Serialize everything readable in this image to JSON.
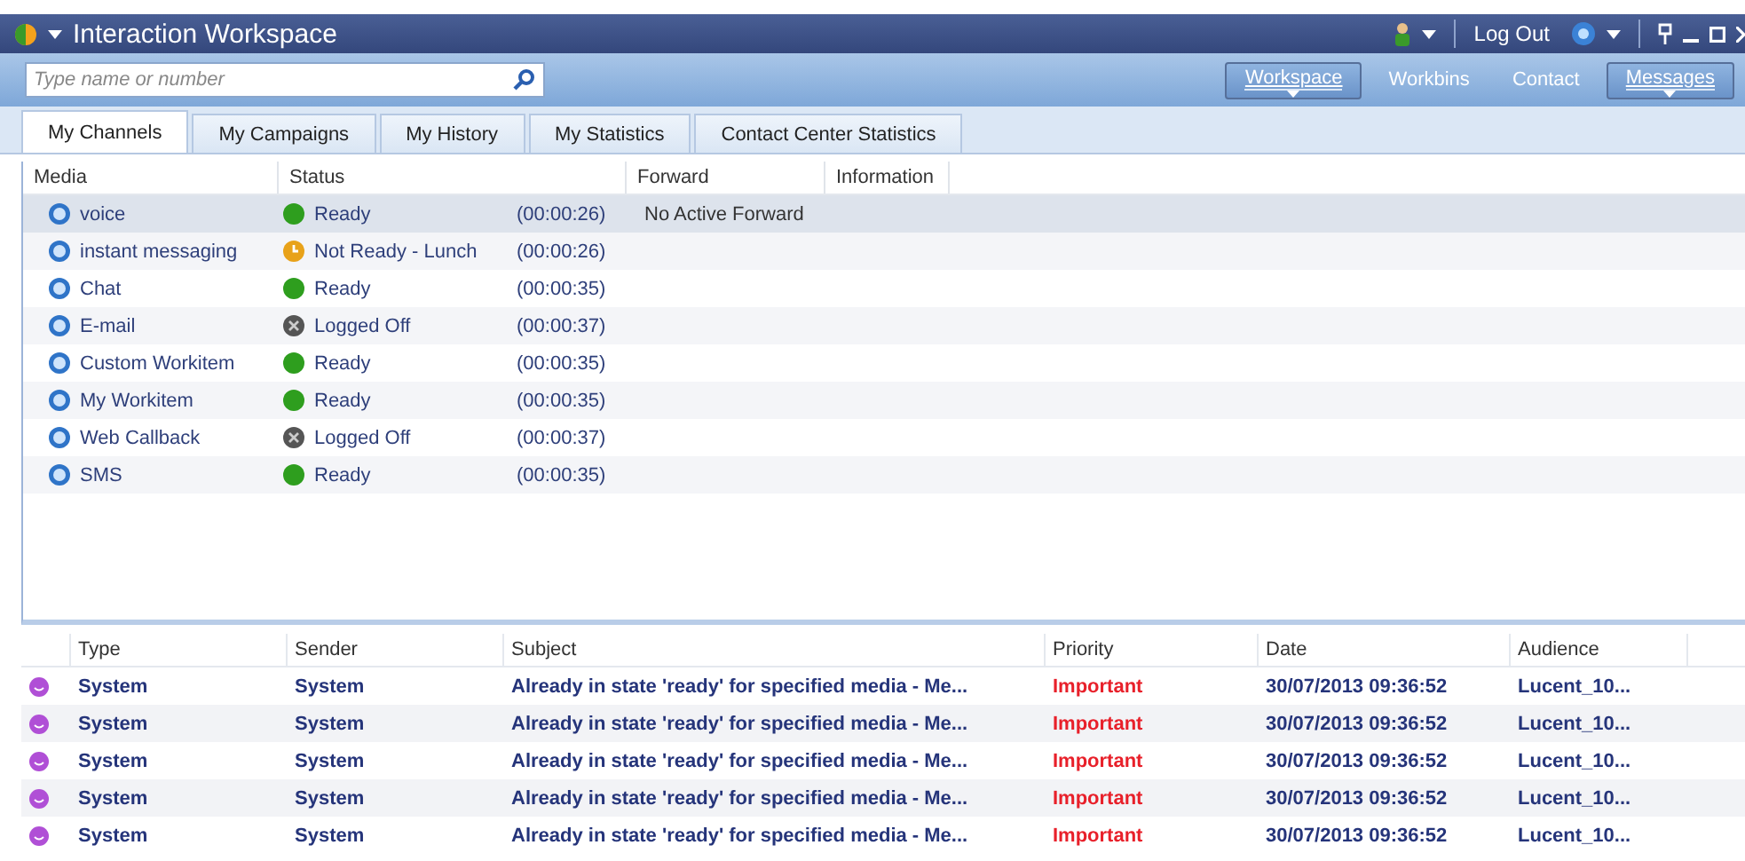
{
  "window": {
    "title": "Interaction Workspace"
  },
  "header": {
    "logout": "Log Out"
  },
  "search": {
    "placeholder": "Type name or number"
  },
  "nav": [
    {
      "label": "Workspace",
      "dropdown": true
    },
    {
      "label": "Workbins",
      "dropdown": false
    },
    {
      "label": "Contact",
      "dropdown": false
    },
    {
      "label": "Messages",
      "dropdown": true
    }
  ],
  "tabs": [
    {
      "label": "My Channels",
      "selected": true
    },
    {
      "label": "My Campaigns",
      "selected": false
    },
    {
      "label": "My History",
      "selected": false
    },
    {
      "label": "My Statistics",
      "selected": false
    },
    {
      "label": "Contact Center Statistics",
      "selected": false
    }
  ],
  "channels": {
    "columns": [
      "Media",
      "Status",
      "Forward",
      "Information"
    ],
    "rows": [
      {
        "media": "voice",
        "status": "Ready",
        "kind": "ready",
        "time": "(00:00:26)",
        "forward": "No Active Forward",
        "selected": true
      },
      {
        "media": "instant messaging",
        "status": "Not Ready - Lunch",
        "kind": "not_ready",
        "time": "(00:00:26)",
        "selected": false
      },
      {
        "media": "Chat",
        "status": "Ready",
        "kind": "ready",
        "time": "(00:00:35)",
        "selected": false
      },
      {
        "media": "E-mail",
        "status": "Logged Off",
        "kind": "logged_off",
        "time": "(00:00:37)",
        "selected": false
      },
      {
        "media": "Custom Workitem",
        "status": "Ready",
        "kind": "ready",
        "time": "(00:00:35)",
        "selected": false
      },
      {
        "media": "My Workitem",
        "status": "Ready",
        "kind": "ready",
        "time": "(00:00:35)",
        "selected": false
      },
      {
        "media": "Web Callback",
        "status": "Logged Off",
        "kind": "logged_off",
        "time": "(00:00:37)",
        "selected": false
      },
      {
        "media": "SMS",
        "status": "Ready",
        "kind": "ready",
        "time": "(00:00:35)",
        "selected": false
      }
    ]
  },
  "messages": {
    "columns": [
      "Type",
      "Sender",
      "Subject",
      "Priority",
      "Date",
      "Audience"
    ],
    "rows": [
      {
        "type": "System",
        "sender": "System",
        "subject": "Already in state 'ready' for specified media - Me...",
        "priority": "Important",
        "date": "30/07/2013 09:36:52",
        "audience": "Lucent_10..."
      },
      {
        "type": "System",
        "sender": "System",
        "subject": "Already in state 'ready' for specified media - Me...",
        "priority": "Important",
        "date": "30/07/2013 09:36:52",
        "audience": "Lucent_10..."
      },
      {
        "type": "System",
        "sender": "System",
        "subject": "Already in state 'ready' for specified media - Me...",
        "priority": "Important",
        "date": "30/07/2013 09:36:52",
        "audience": "Lucent_10..."
      },
      {
        "type": "System",
        "sender": "System",
        "subject": "Already in state 'ready' for specified media - Me...",
        "priority": "Important",
        "date": "30/07/2013 09:36:52",
        "audience": "Lucent_10..."
      },
      {
        "type": "System",
        "sender": "System",
        "subject": "Already in state 'ready' for specified media - Me...",
        "priority": "Important",
        "date": "30/07/2013 09:36:52",
        "audience": "Lucent_10..."
      }
    ]
  }
}
